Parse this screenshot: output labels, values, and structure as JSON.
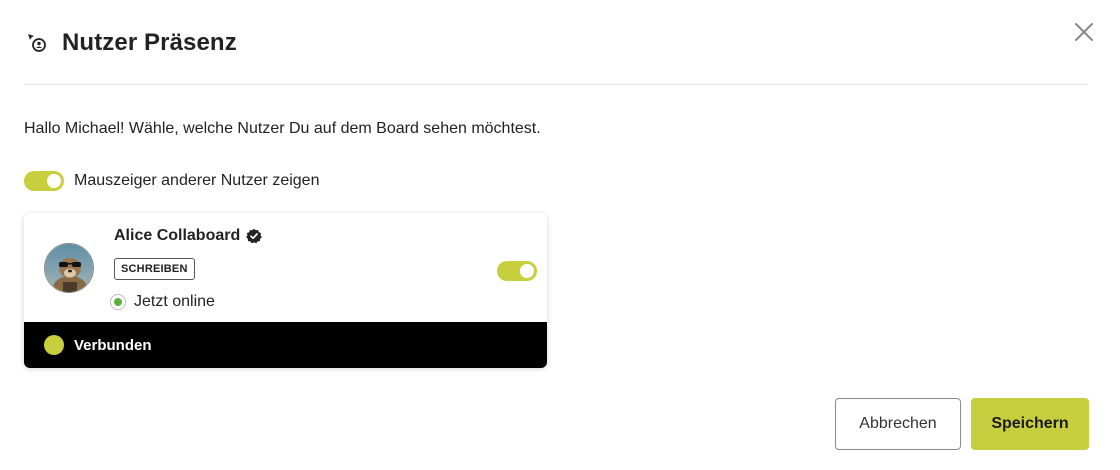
{
  "dialog": {
    "title": "Nutzer Präsenz",
    "header_icon": "user-cursor-icon",
    "close_icon": "close-icon",
    "intro": "Hallo Michael! Wähle, welche Nutzer Du auf dem Board sehen möchtest.",
    "show_cursors": {
      "label": "Mauszeiger anderer Nutzer zeigen",
      "enabled": true
    }
  },
  "users": [
    {
      "name": "Alice Collaboard",
      "verified_icon": "verified-badge-icon",
      "role": "SCHREIBEN",
      "status": "Jetzt online",
      "visible": true,
      "connection": "Verbunden"
    }
  ],
  "buttons": {
    "cancel": "Abbrechen",
    "save": "Speichern"
  },
  "colors": {
    "accent": "#c8cf3f",
    "online": "#5fb13d",
    "footer_bg": "#000000"
  }
}
